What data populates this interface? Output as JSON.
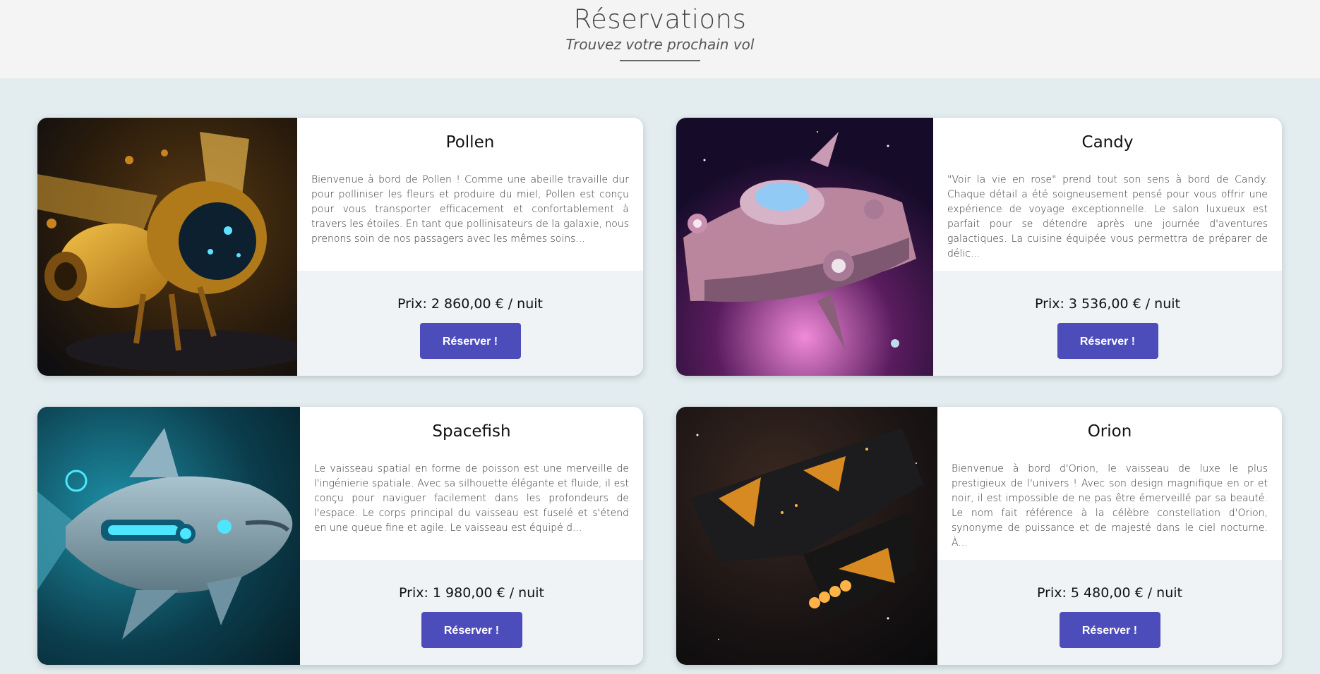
{
  "header": {
    "title": "Réservations",
    "subtitle": "Trouvez votre prochain vol"
  },
  "colors": {
    "button": "#4c4cbb",
    "background": "#e3edf0",
    "price_panel": "#eff3f6"
  },
  "cards": [
    {
      "name": "Pollen",
      "image_icon": "golden-bee-spaceship-image",
      "description": "Bienvenue à bord de Pollen ! Comme une abeille travaille dur pour polliniser les fleurs et produire du miel, Pollen est conçu pour vous transporter efficacement et confortablement à travers les étoiles. En tant que pollinisateurs de la galaxie, nous prenons soin de nos passagers avec les mêmes soins...",
      "price": "Prix: 2 860,00 € / nuit",
      "button": "Réserver !"
    },
    {
      "name": "Candy",
      "image_icon": "pink-spaceship-image",
      "description": "\"Voir la vie en rose\" prend tout son sens à bord de Candy. Chaque détail a été soigneusement pensé pour vous offrir une expérience de voyage exceptionnelle. Le salon luxueux est parfait pour se détendre après une journée d'aventures galactiques. La cuisine équipée vous permettra de préparer de délic...",
      "price": "Prix: 3 536,00 € / nuit",
      "button": "Réserver !"
    },
    {
      "name": "Spacefish",
      "image_icon": "cyan-fish-spaceship-image",
      "description": "Le vaisseau spatial en forme de poisson est une merveille de l'ingénierie spatiale. Avec sa silhouette élégante et fluide, il est conçu pour naviguer facilement dans les profondeurs de l'espace. Le corps principal du vaisseau est fuselé et s'étend en une queue fine et agile. Le vaisseau est équipé d...",
      "price": "Prix: 1 980,00 € / nuit",
      "button": "Réserver !"
    },
    {
      "name": "Orion",
      "image_icon": "black-gold-spaceship-image",
      "description": "Bienvenue à bord d'Orion, le vaisseau de luxe le plus prestigieux de l'univers ! Avec son design magnifique en or et noir, il est impossible de ne pas être émerveillé par sa beauté. Le nom fait référence à la célèbre constellation d'Orion, synonyme de puissance et de majesté dans le ciel nocturne. À...",
      "price": "Prix: 5 480,00 € / nuit",
      "button": "Réserver !"
    }
  ]
}
